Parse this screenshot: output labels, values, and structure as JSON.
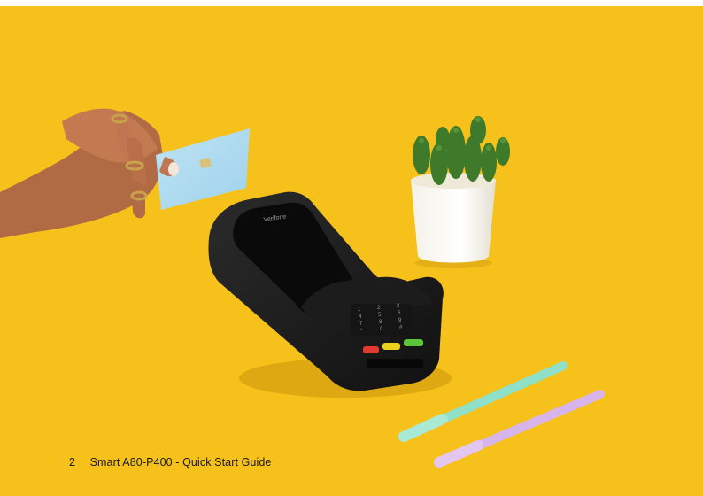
{
  "footer": {
    "page_number": "2",
    "title": "Smart A80-P400 - Quick Start Guide"
  },
  "photo": {
    "background_color": "#f6c11a",
    "device_brand": "Verifone",
    "keypad_keys": [
      "1",
      "2",
      "3",
      "4",
      "5",
      "6",
      "7",
      "8",
      "9",
      "*",
      "0",
      "#"
    ]
  }
}
